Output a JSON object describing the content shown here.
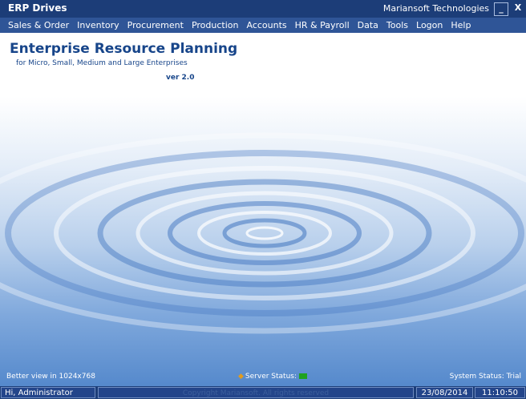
{
  "window": {
    "app_title": "ERP Drives",
    "company": "Mariansoft Technologies",
    "minimize_label": "_",
    "close_label": "X"
  },
  "menu": [
    {
      "label": "Sales & Order"
    },
    {
      "label": "Inventory"
    },
    {
      "label": "Procurement"
    },
    {
      "label": "Production"
    },
    {
      "label": "Accounts"
    },
    {
      "label": "HR & Payroll"
    },
    {
      "label": "Data"
    },
    {
      "label": "Tools"
    },
    {
      "label": "Logon"
    },
    {
      "label": "Help"
    }
  ],
  "main": {
    "heading": "Enterprise Resource Planning",
    "subheading": "for Micro, Small, Medium and Large Enterprises",
    "version": "ver 2.0",
    "better_view": "Better view in 1024x768",
    "server_status_label": "Server Status:",
    "server_status_color": "#1fa21f",
    "system_status": "System Status: Trial"
  },
  "statusbar": {
    "user": "Hi, Administrator",
    "copyright": "Copyright Mariansoft. All rights reserved",
    "date": "23/08/2014",
    "time": "11:10:50"
  },
  "colors": {
    "titlebar": "#1c3d78",
    "menubar": "#2f5597",
    "heading": "#17458a"
  }
}
